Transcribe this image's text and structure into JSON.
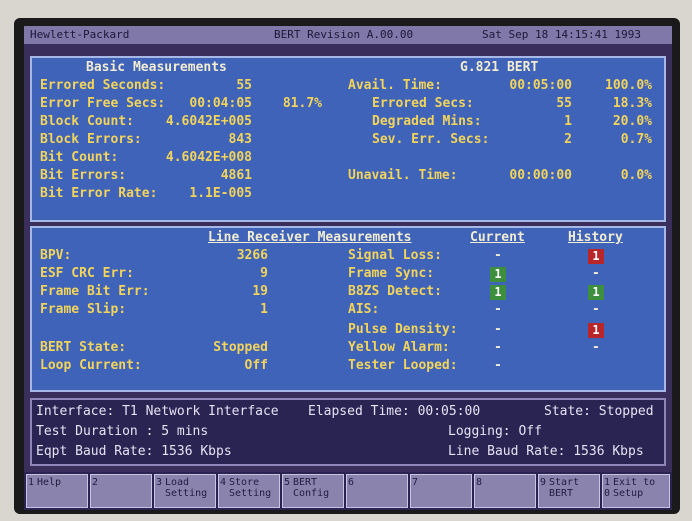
{
  "header": {
    "vendor": "Hewlett-Packard",
    "revision": "BERT Revision A.00.00",
    "datetime": "Sat Sep 18 14:15:41 1993"
  },
  "basic": {
    "title": "Basic Measurements",
    "errored_seconds_label": "Errored Seconds:",
    "errored_seconds": "55",
    "error_free_label": "Error Free Secs:",
    "error_free": "00:04:05",
    "error_free_pct": "81.7%",
    "block_count_label": "Block Count:",
    "block_count": "4.6042E+005",
    "block_errors_label": "Block Errors:",
    "block_errors": "843",
    "bit_count_label": "Bit Count:",
    "bit_count": "4.6042E+008",
    "bit_errors_label": "Bit Errors:",
    "bit_errors": "4861",
    "bit_error_rate_label": "Bit Error Rate:",
    "bit_error_rate": "1.1E-005"
  },
  "g821": {
    "title": "G.821 BERT",
    "avail_time_label": "Avail. Time:",
    "avail_time": "00:05:00",
    "avail_time_pct": "100.0%",
    "errored_secs_label": "Errored Secs:",
    "errored_secs": "55",
    "errored_secs_pct": "18.3%",
    "degraded_mins_label": "Degraded Mins:",
    "degraded_mins": "1",
    "degraded_mins_pct": "20.0%",
    "sev_err_secs_label": "Sev. Err. Secs:",
    "sev_err_secs": "2",
    "sev_err_secs_pct": "0.7%",
    "unavail_time_label": "Unavail. Time:",
    "unavail_time": "00:00:00",
    "unavail_time_pct": "0.0%"
  },
  "receiver": {
    "title": "Line Receiver Measurements",
    "current_header": "Current",
    "history_header": "History",
    "bpv_label": "BPV:",
    "bpv": "3266",
    "esf_label": "ESF CRC Err:",
    "esf": "9",
    "frame_bit_label": "Frame Bit Err:",
    "frame_bit": "19",
    "frame_slip_label": "Frame Slip:",
    "frame_slip": "1",
    "bert_state_label": "BERT State:",
    "bert_state": "Stopped",
    "loop_current_label": "Loop Current:",
    "loop_current": "Off",
    "alarms": [
      {
        "label": "Signal Loss:",
        "current": "-",
        "history": "1"
      },
      {
        "label": "Frame Sync:",
        "current": "1",
        "history": "-"
      },
      {
        "label": "B8ZS Detect:",
        "current": "1",
        "history": "1"
      },
      {
        "label": "AIS:",
        "current": "-",
        "history": "-"
      },
      {
        "label": "Pulse Density:",
        "current": "-",
        "history": "1"
      },
      {
        "label": "Yellow Alarm:",
        "current": "-",
        "history": "-"
      },
      {
        "label": "Tester Looped:",
        "current": "-",
        "history": ""
      }
    ]
  },
  "info": {
    "interface": "Interface: T1 Network Interface",
    "elapsed": "Elapsed Time: 00:05:00",
    "state": "State: Stopped",
    "test_duration": "Test Duration : 5 mins",
    "logging": "Logging: Off",
    "eqpt_baud": "Eqpt Baud Rate: 1536 Kbps",
    "line_baud": "Line Baud Rate: 1536 Kbps"
  },
  "fkeys": [
    {
      "num": "1",
      "line1": "Help",
      "line2": ""
    },
    {
      "num": "2",
      "line1": "",
      "line2": ""
    },
    {
      "num": "3",
      "line1": "Load",
      "line2": "Setting"
    },
    {
      "num": "4",
      "line1": "Store",
      "line2": "Setting"
    },
    {
      "num": "5",
      "line1": "BERT",
      "line2": "Config"
    },
    {
      "num": "6",
      "line1": "",
      "line2": ""
    },
    {
      "num": "7",
      "line1": "",
      "line2": ""
    },
    {
      "num": "8",
      "line1": "",
      "line2": ""
    },
    {
      "num": "9",
      "line1": "Start",
      "line2": "BERT"
    },
    {
      "num": "1\n0",
      "line1": "Exit to",
      "line2": "Setup"
    }
  ]
}
